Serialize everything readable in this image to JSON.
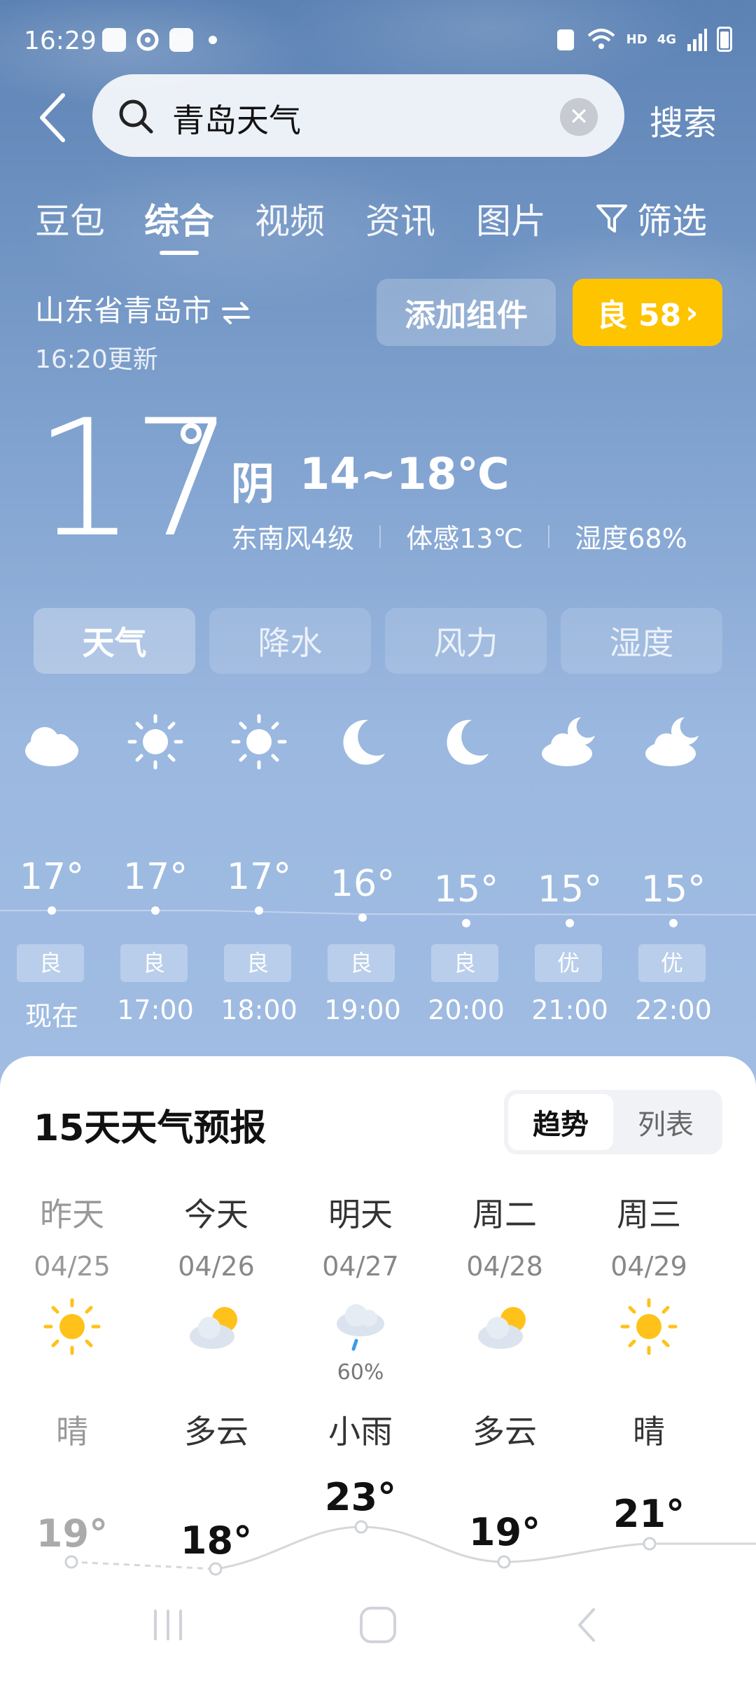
{
  "status_bar": {
    "time": "16:29",
    "network": "HD",
    "signal": "4G"
  },
  "search": {
    "query": "青岛天气",
    "button_label": "搜索"
  },
  "tabs": {
    "items": [
      "豆包",
      "综合",
      "视频",
      "资讯",
      "图片"
    ],
    "active": "综合",
    "filter_label": "筛选"
  },
  "location": {
    "name": "山东省青岛市",
    "updated": "16:20更新",
    "add_widget": "添加组件",
    "aqi_label": "良 58"
  },
  "current": {
    "temp": "17",
    "condition": "阴",
    "range": "14~18℃",
    "wind": "东南风4级",
    "feels_like": "体感13℃",
    "humidity": "湿度68%"
  },
  "segments": {
    "items": [
      "天气",
      "降水",
      "风力",
      "湿度"
    ],
    "active": "天气"
  },
  "hourly": [
    {
      "time": "现在",
      "temp": "17°",
      "aqi": "良",
      "icon": "cloud-icon"
    },
    {
      "time": "17:00",
      "temp": "17°",
      "aqi": "良",
      "icon": "sun-icon"
    },
    {
      "time": "18:00",
      "temp": "17°",
      "aqi": "良",
      "icon": "sun-icon"
    },
    {
      "time": "19:00",
      "temp": "16°",
      "aqi": "良",
      "icon": "moon-icon"
    },
    {
      "time": "20:00",
      "temp": "15°",
      "aqi": "良",
      "icon": "moon-icon"
    },
    {
      "time": "21:00",
      "temp": "15°",
      "aqi": "优",
      "icon": "moon-cloud-icon"
    },
    {
      "time": "22:00",
      "temp": "15°",
      "aqi": "优",
      "icon": "moon-cloud-icon"
    }
  ],
  "forecast": {
    "title": "15天天气预报",
    "toggle": [
      "趋势",
      "列表"
    ],
    "toggle_active": "趋势",
    "days": [
      {
        "name": "昨天",
        "date": "04/25",
        "icon": "sun-icon",
        "cond": "晴",
        "high": "19°"
      },
      {
        "name": "今天",
        "date": "04/26",
        "icon": "partly-cloudy-icon",
        "cond": "多云",
        "high": "18°"
      },
      {
        "name": "明天",
        "date": "04/27",
        "icon": "rain-cloud-icon",
        "precip": "60%",
        "cond": "小雨",
        "high": "23°"
      },
      {
        "name": "周二",
        "date": "04/28",
        "icon": "partly-cloudy-icon",
        "cond": "多云",
        "high": "19°"
      },
      {
        "name": "周三",
        "date": "04/29",
        "icon": "sun-icon",
        "cond": "晴",
        "high": "21°"
      }
    ]
  }
}
